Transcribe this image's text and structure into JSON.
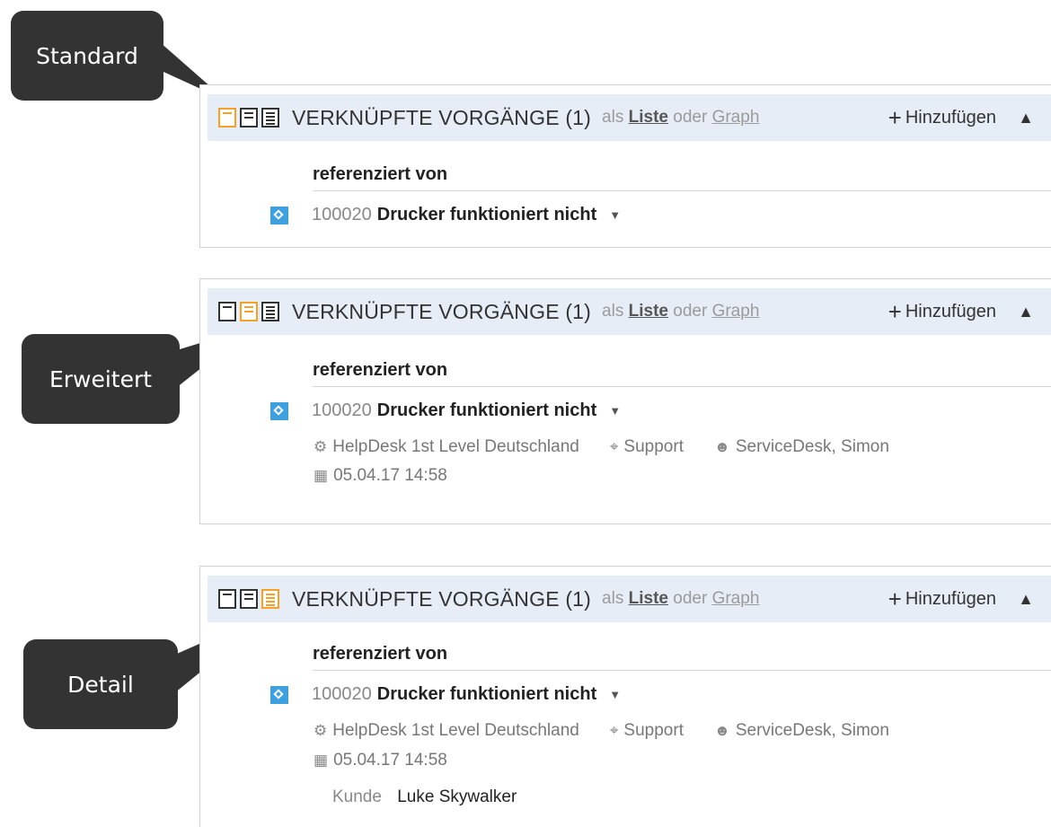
{
  "callouts": [
    {
      "label": "Standard"
    },
    {
      "label": "Erweitert"
    },
    {
      "label": "Detail"
    }
  ],
  "colors": {
    "callout_bg": "#333333",
    "active_view": "#f5a02a",
    "header_bg": "#e7edf6",
    "issue_badge": "#3fa0e0"
  },
  "panels": [
    {
      "view": "Standard",
      "title": "VERKNÜPFTE VORGÄNGE (1)",
      "as_prefix": "als",
      "as_list": "Liste",
      "as_or": "oder",
      "as_graph": "Graph",
      "add_label": "Hinzufügen",
      "add_icon": "plus-icon",
      "collapse_icon": "chevron-up-icon",
      "ref_label": "referenziert von",
      "issue": {
        "id": "100020",
        "title": "Drucker funktioniert nicht"
      }
    },
    {
      "view": "Erweitert",
      "title": "VERKNÜPFTE VORGÄNGE (1)",
      "as_prefix": "als",
      "as_list": "Liste",
      "as_or": "oder",
      "as_graph": "Graph",
      "add_label": "Hinzufügen",
      "ref_label": "referenziert von",
      "issue": {
        "id": "100020",
        "title": "Drucker funktioniert nicht",
        "group": "HelpDesk 1st Level Deutschland",
        "category": "Support",
        "assignee": "ServiceDesk, Simon",
        "date": "05.04.17 14:58"
      }
    },
    {
      "view": "Detail",
      "title": "VERKNÜPFTE VORGÄNGE (1)",
      "as_prefix": "als",
      "as_list": "Liste",
      "as_or": "oder",
      "as_graph": "Graph",
      "add_label": "Hinzufügen",
      "ref_label": "referenziert von",
      "issue": {
        "id": "100020",
        "title": "Drucker funktioniert nicht",
        "group": "HelpDesk 1st Level Deutschland",
        "category": "Support",
        "assignee": "ServiceDesk, Simon",
        "date": "05.04.17 14:58",
        "customer_key": "Kunde",
        "customer_value": "Luke Skywalker"
      }
    }
  ]
}
